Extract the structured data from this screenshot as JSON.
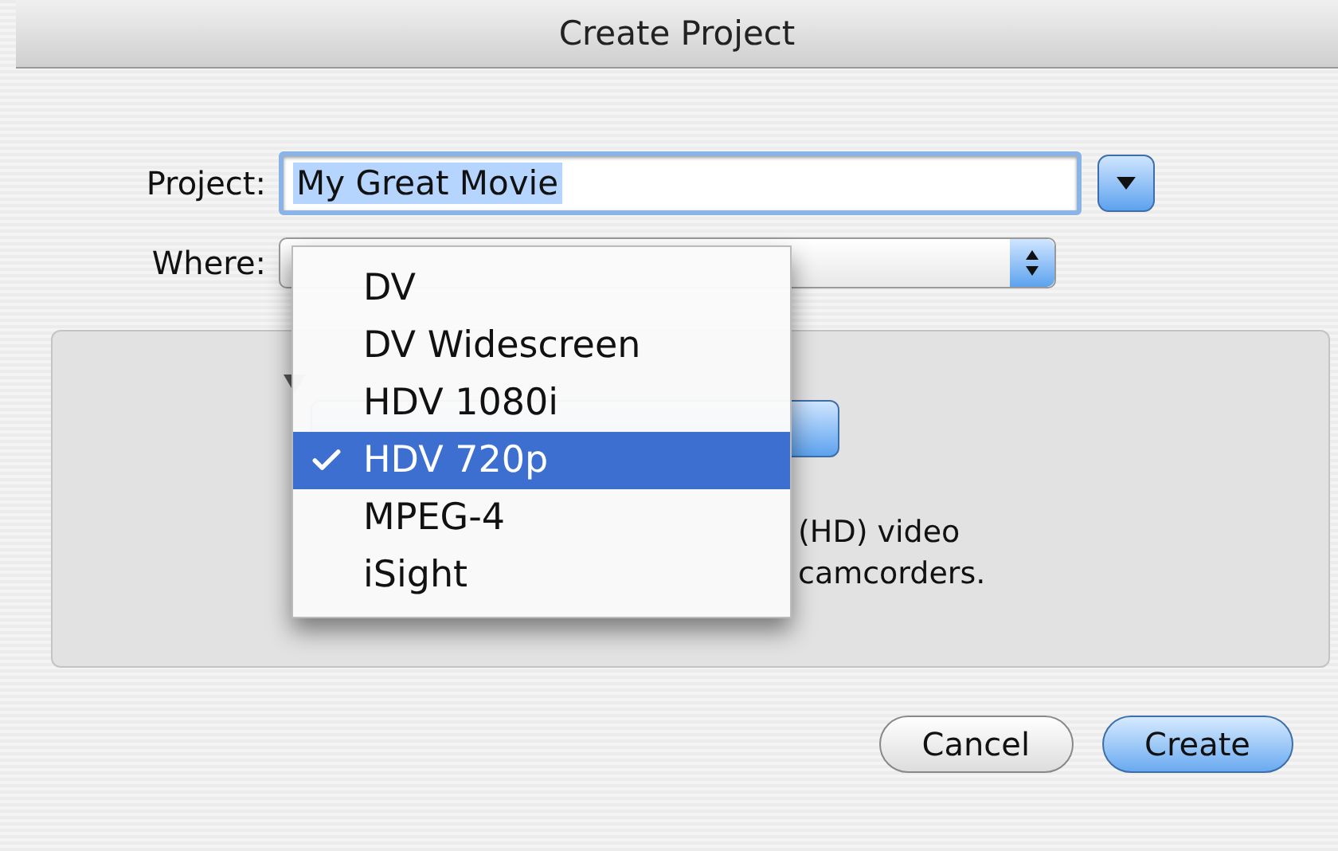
{
  "window": {
    "title": "Create Project"
  },
  "project": {
    "label": "Project:",
    "value": "My Great Movie",
    "selected_text": true
  },
  "where": {
    "label": "Where:"
  },
  "video_format_menu": {
    "items": [
      {
        "label": "DV",
        "selected": false
      },
      {
        "label": "DV Widescreen",
        "selected": false
      },
      {
        "label": "HDV 1080i",
        "selected": false
      },
      {
        "label": "HDV 720p",
        "selected": true
      },
      {
        "label": "MPEG-4",
        "selected": false
      },
      {
        "label": "iSight",
        "selected": false
      }
    ]
  },
  "description": [
    "(HD) video",
    "camcorders."
  ],
  "buttons": [
    {
      "label": "Cancel",
      "default": false
    },
    {
      "label": "Create",
      "default": true
    }
  ]
}
